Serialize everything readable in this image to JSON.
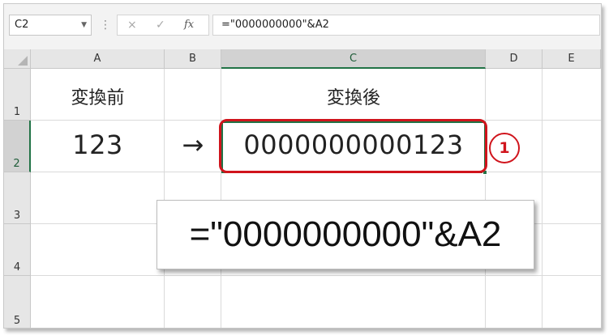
{
  "name_box": {
    "value": "C2"
  },
  "formula_bar": {
    "separator": "⋮",
    "cancel_icon": "×",
    "enter_icon": "✓",
    "fx_label": "fx",
    "formula": "=\"0000000000\"&A2"
  },
  "columns": [
    "A",
    "B",
    "C",
    "D",
    "E"
  ],
  "selected_column": "C",
  "rows": [
    "1",
    "2",
    "3",
    "4",
    "5"
  ],
  "selected_row": "2",
  "cells": {
    "A1": "変換前",
    "C1": "変換後",
    "A2": "123",
    "B2": "→",
    "C2": "0000000000123"
  },
  "annotation": {
    "marker": "1",
    "callout": "=\"0000000000\"&A2"
  },
  "colors": {
    "accent": "#217346",
    "highlight": "#d0141c"
  }
}
